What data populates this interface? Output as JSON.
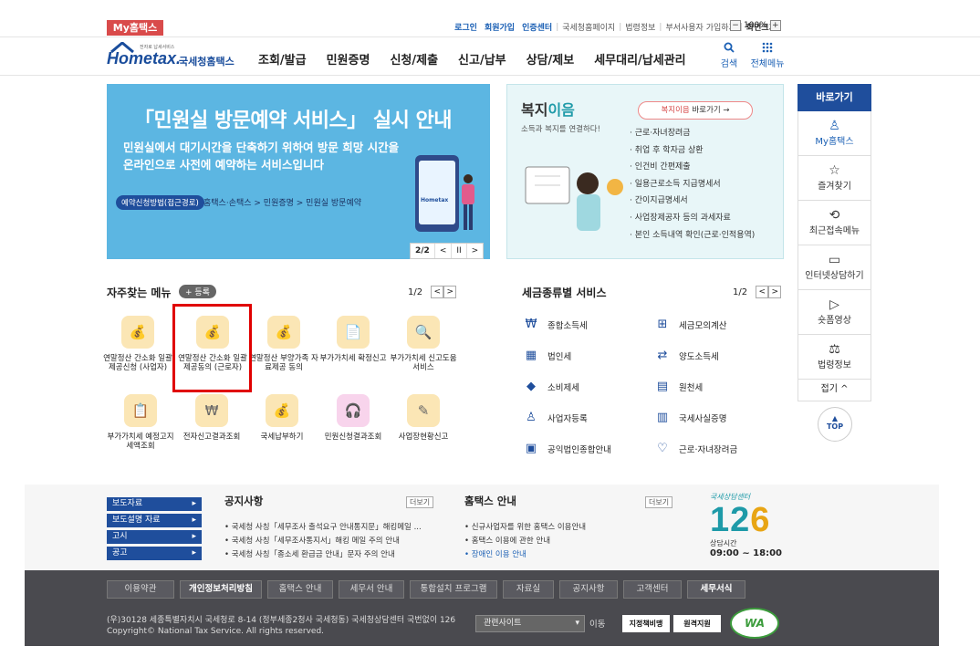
{
  "topbar": {
    "my_hometax": "My홈택스",
    "links": [
      "로그인",
      "회원가입",
      "인증센터",
      "국세청홈페이지",
      "법령정보",
      "부서사용자 가입하기",
      "화면크기"
    ],
    "zoom": "100%",
    "zoom_minus": "−",
    "zoom_plus": "+"
  },
  "header": {
    "logo_tiny": "전자로 납세서비스",
    "logo_main": "Hometax.",
    "logo_sub": "국세청홈택스",
    "nav": [
      "조회/발급",
      "민원증명",
      "신청/제출",
      "신고/납부",
      "상담/제보",
      "세무대리/납세관리"
    ],
    "search_label": "검색",
    "allmenu_label": "전체메뉴",
    "search_icon": "search-icon",
    "allmenu_icon": "grid-icon"
  },
  "banner": {
    "title": "「민원실 방문예약 서비스」 실시 안내",
    "desc1": "민원실에서 대기시간을 단축하기 위하여 방문 희망 시간을",
    "desc2": "온라인으로 사전에 예약하는 서비스입니다",
    "pill": "예약신청방법(접근경로)",
    "path": "홈택스·손택스 > 민원증명 > 민원실 방문예약",
    "phone_text": "Hometax",
    "page": "2/2",
    "prev": "<",
    "pause": "II",
    "next": ">",
    "color": "#5cb6e2"
  },
  "welfare": {
    "title_a": "복지",
    "title_b": "이음",
    "subtitle": "소득과 복지를 연결하다!",
    "button_a": "복지이음",
    "button_b": " 바로가기",
    "items": [
      "근로·자녀장려금",
      "취업 후 학자금 상환",
      "인건비 간편제출",
      "일용근로소득 지급명세서",
      "간이지급명세서",
      "사업장제공자 등의 과세자료",
      "본인 소득내역 확인(근로·인적용역)"
    ]
  },
  "quick": {
    "header": "바로가기",
    "items": [
      {
        "label": "My홈택스",
        "icon": "person-icon",
        "glyph": "♙"
      },
      {
        "label": "즐겨찾기",
        "icon": "star-icon",
        "glyph": "☆"
      },
      {
        "label": "최근접속메뉴",
        "icon": "recent-icon",
        "glyph": "⟲"
      },
      {
        "label": "인터넷상담하기",
        "icon": "laptop-icon",
        "glyph": "▭"
      },
      {
        "label": "숏폼영상",
        "icon": "play-icon",
        "glyph": "▷"
      },
      {
        "label": "법령정보",
        "icon": "gavel-icon",
        "glyph": "⚖"
      }
    ],
    "fold": "접기 ^",
    "top": "TOP",
    "top_arrow": "▲"
  },
  "favorites": {
    "title": "자주찾는 메뉴",
    "add": "+ 등록",
    "page": "1/2",
    "prev": "<",
    "next": ">",
    "items": [
      {
        "label": "연말정산 간소화 일괄제공신청 (사업자)",
        "icon": "money-bag-icon",
        "glyph": "💰"
      },
      {
        "label": "연말정산 간소화 일괄제공동의 (근로자)",
        "icon": "money-bag-icon",
        "glyph": "💰"
      },
      {
        "label": "연말정산 부양가족 자료제공 동의",
        "icon": "money-bag-icon",
        "glyph": "💰"
      },
      {
        "label": "부가가치세 확정신고",
        "icon": "vat-document-icon",
        "glyph": "📄"
      },
      {
        "label": "부가가치세 신고도움 서비스",
        "icon": "document-search-icon",
        "glyph": "🔍"
      },
      {
        "label": "부가가치세 예정고지 세액조회",
        "icon": "document-money-icon",
        "glyph": "📋"
      },
      {
        "label": "전자신고결과조회",
        "icon": "won-search-icon",
        "glyph": "₩"
      },
      {
        "label": "국세납부하기",
        "icon": "money-bag-icon",
        "glyph": "💰"
      },
      {
        "label": "민원신청결과조회",
        "icon": "headset-icon",
        "glyph": "🎧"
      },
      {
        "label": "사업장현황신고",
        "icon": "edit-document-icon",
        "glyph": "✎"
      }
    ]
  },
  "tax_services": {
    "title": "세금종류별 서비스",
    "page": "1/2",
    "prev": "<",
    "next": ">",
    "items": [
      {
        "label": "종합소득세",
        "icon": "won-hand-icon",
        "glyph": "₩"
      },
      {
        "label": "세금모의계산",
        "icon": "calculator-icon",
        "glyph": "⊞"
      },
      {
        "label": "법인세",
        "icon": "building-icon",
        "glyph": "▦"
      },
      {
        "label": "양도소득세",
        "icon": "transfer-icon",
        "glyph": "⇄"
      },
      {
        "label": "소비제세",
        "icon": "diamond-icon",
        "glyph": "◆"
      },
      {
        "label": "원천세",
        "icon": "receipt-icon",
        "glyph": "▤"
      },
      {
        "label": "사업자등록",
        "icon": "person-icon",
        "glyph": "♙"
      },
      {
        "label": "국세사실증명",
        "icon": "document-icon",
        "glyph": "▥"
      },
      {
        "label": "공익법인종합안내",
        "icon": "clipboard-icon",
        "glyph": "▣"
      },
      {
        "label": "근로·자녀장려금",
        "icon": "heart-icon",
        "glyph": "♡"
      }
    ]
  },
  "lower": {
    "side_tabs": [
      "보도자료",
      "보도설명 자료",
      "고시",
      "공고"
    ],
    "notice_title": "공지사항",
    "notice_more": "더보기",
    "notices": [
      "국세청 사칭「세무조사 출석요구 안내통지문」해킹메일 ...",
      "국세청 사칭「세무조사통지서」해킹 메일 주의 안내",
      "국세청 사칭「종소세 환급금 안내」문자 주의 안내"
    ],
    "ht_title": "홈택스 안내",
    "ht_more": "더보기",
    "ht_items": [
      "신규사업자를 위한 홈택스 이용안내",
      "홈택스 이용에 관한 안내",
      "장애인 이용 안내"
    ],
    "center_top": "국세상담센터",
    "center_num_a": "12",
    "center_num_b": "6",
    "center_hours_label": "상담시간",
    "center_hours": "09:00 ~ 18:00"
  },
  "footer": {
    "nav": [
      "이용약관",
      "개인정보처리방침",
      "홈택스 안내",
      "세무서 안내",
      "통합설치 프로그램",
      "자료실",
      "공지사항",
      "고객센터",
      "세무서식"
    ],
    "address": "(우)30128 세종특별자치시 국세청로 8-14 (정부세종2청사 국세청동) 국세청상담센터 국번없이 126",
    "copyright": "Copyright© National Tax Service. All rights reserved.",
    "related": "관련사이트",
    "go": "이동",
    "badge1": "지정책비맹",
    "badge2": "원격지원",
    "wa": "WA"
  }
}
